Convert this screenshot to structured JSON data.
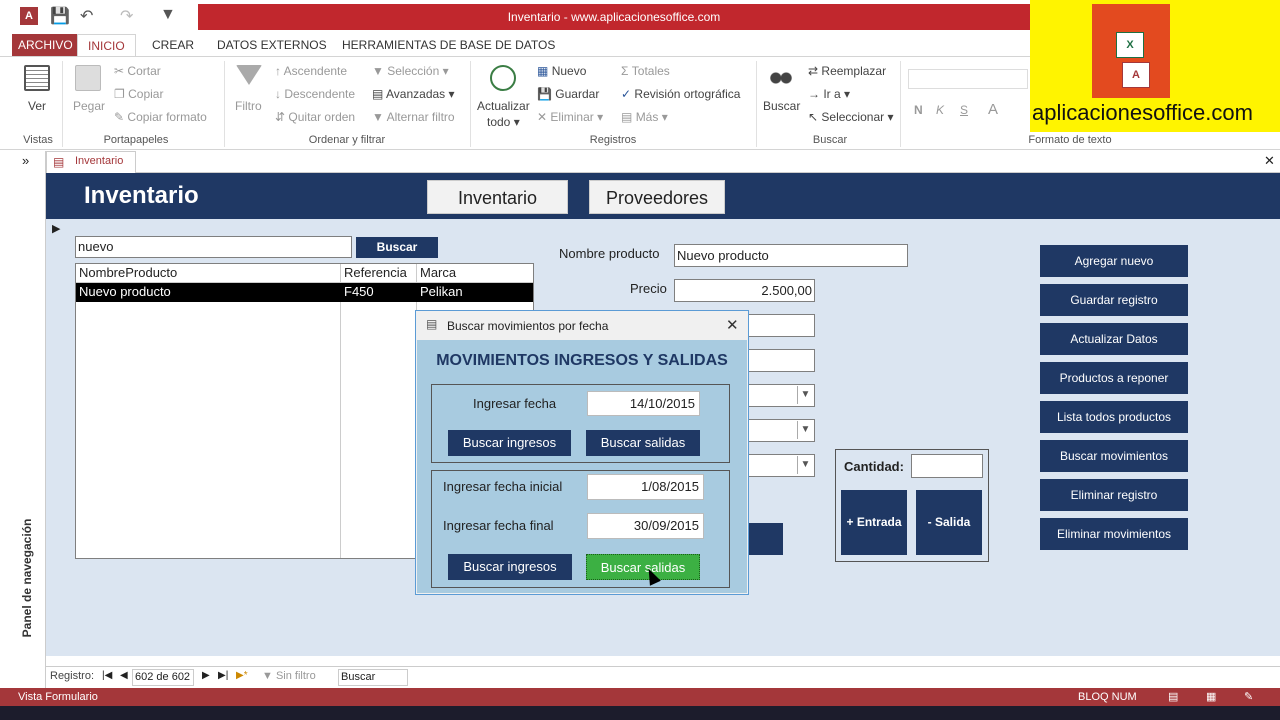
{
  "window": {
    "title": "Inventario - www.aplicacionesoffice.com"
  },
  "ribbon_tabs": [
    "ARCHIVO",
    "INICIO",
    "CREAR",
    "DATOS EXTERNOS",
    "HERRAMIENTAS DE BASE DE DATOS"
  ],
  "ribbon": {
    "vistas": {
      "ver": "Ver",
      "group": "Vistas"
    },
    "portapapeles": {
      "pegar": "Pegar",
      "cortar": "Cortar",
      "copiar": "Copiar",
      "copiar_formato": "Copiar formato",
      "group": "Portapapeles"
    },
    "ordenar": {
      "filtro": "Filtro",
      "ascendente": "Ascendente",
      "descendente": "Descendente",
      "quitar_orden": "Quitar orden",
      "seleccion": "Selección",
      "avanzadas": "Avanzadas",
      "alternar_filtro": "Alternar filtro",
      "group": "Ordenar y filtrar"
    },
    "registros": {
      "actualizar": "Actualizar",
      "todo": "todo",
      "nuevo": "Nuevo",
      "guardar": "Guardar",
      "eliminar": "Eliminar",
      "totales": "Totales",
      "revision": "Revisión ortográfica",
      "mas": "Más",
      "group": "Registros"
    },
    "buscar": {
      "buscar": "Buscar",
      "reemplazar": "Reemplazar",
      "ir_a": "Ir a",
      "seleccionar": "Seleccionar",
      "group": "Buscar"
    },
    "formato": {
      "group": "Formato de texto",
      "n": "N",
      "k": "K",
      "s": "S"
    }
  },
  "logo": {
    "text": "aplicacionesoffice.com"
  },
  "doc_tab": "Inventario",
  "nav_pane": "Panel de navegación",
  "form": {
    "title": "Inventario",
    "nav_inventario": "Inventario",
    "nav_proveedores": "Proveedores",
    "search_value": "nuevo",
    "search_button": "Buscar",
    "list": {
      "headers": [
        "NombreProducto",
        "Referencia",
        "Marca"
      ],
      "rows": [
        [
          "Nuevo producto",
          "F450",
          "Pelikan"
        ]
      ]
    },
    "nombre_label": "Nombre producto",
    "nombre_value": "Nuevo producto",
    "precio_label": "Precio",
    "precio_value": "2.500,00",
    "cantidad_label": "Cantidad:",
    "entrada": "+ Entrada",
    "salida": "- Salida",
    "actions": [
      "Agregar nuevo",
      "Guardar registro",
      "Actualizar Datos",
      "Productos a reponer",
      "Lista todos productos",
      "Buscar movimientos",
      "Eliminar registro",
      "Eliminar movimientos"
    ]
  },
  "dialog": {
    "title": "Buscar movimientos por fecha",
    "heading": "MOVIMIENTOS INGRESOS Y SALIDAS",
    "fecha_label": "Ingresar fecha",
    "fecha_value": "14/10/2015",
    "btn_ingresos_1": "Buscar ingresos",
    "btn_salidas_1": "Buscar salidas",
    "fecha_ini_label": "Ingresar fecha inicial",
    "fecha_ini_value": "1/08/2015",
    "fecha_fin_label": "Ingresar fecha final",
    "fecha_fin_value": "30/09/2015",
    "btn_ingresos_2": "Buscar ingresos",
    "btn_salidas_2": "Buscar salidas"
  },
  "record_bar": {
    "label": "Registro:",
    "position": "602 de 602",
    "filter": "Sin filtro",
    "search": "Buscar"
  },
  "status": {
    "left": "Vista Formulario",
    "right": "BLOQ NUM"
  },
  "colors": {
    "access_red": "#a4373a",
    "navy": "#1f3864",
    "form_bg": "#dbe5f1",
    "dialog_bg": "#a8cbe0",
    "green_btn": "#3cb043"
  }
}
